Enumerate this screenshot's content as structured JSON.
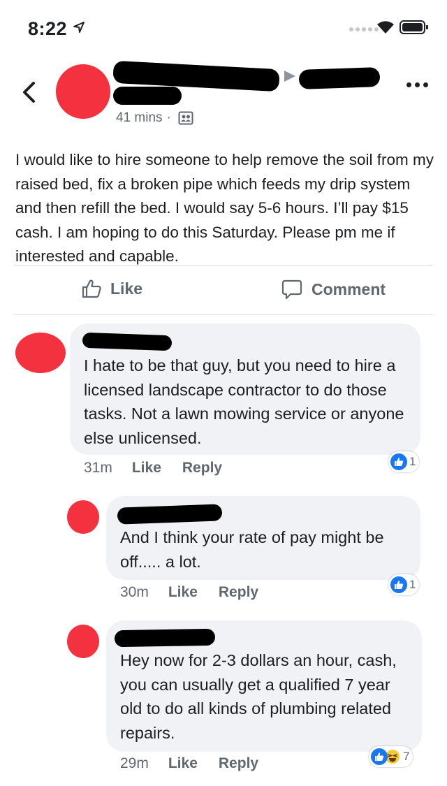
{
  "status_bar": {
    "time": "8:22"
  },
  "post": {
    "time": "41 mins",
    "text": "I would like to hire someone to help remove the soil from my raised bed, fix a broken pipe which feeds my drip system and then refill the bed. I would say 5-6 hours. I’ll pay $15 cash. I am hoping to do this Saturday. Please pm me if interested and capable."
  },
  "actions": {
    "like_label": "Like",
    "comment_label": "Comment"
  },
  "comments": [
    {
      "text": "I hate to be that guy, but you need to hire a licensed landscape contractor to do those tasks. Not a lawn mowing service or anyone else unlicensed.",
      "time": "31m",
      "like_label": "Like",
      "reply_label": "Reply",
      "reactions": [
        "like"
      ],
      "reaction_count": "1"
    },
    {
      "text": "And I think your rate of pay might be off..... a lot.",
      "time": "30m",
      "like_label": "Like",
      "reply_label": "Reply",
      "reactions": [
        "like"
      ],
      "reaction_count": "1"
    },
    {
      "text": "Hey now for 2-3 dollars an hour, cash, you can usually get a qualified 7 year old to do all kinds of plumbing related repairs.",
      "time": "29m",
      "like_label": "Like",
      "reply_label": "Reply",
      "reactions": [
        "like",
        "haha"
      ],
      "reaction_count": "7"
    }
  ],
  "colors": {
    "avatar_red": "#f4313f",
    "bubble_gray": "#f0f2f5",
    "like_blue": "#1877f2",
    "meta_gray": "#606770"
  },
  "icons": [
    "location-arrow-icon",
    "wifi-icon",
    "battery-icon",
    "back-chevron-icon",
    "more-options-icon",
    "share-arrow-icon",
    "audience-icon",
    "like-thumb-icon",
    "comment-icon",
    "like-reaction-icon",
    "haha-reaction-icon"
  ]
}
